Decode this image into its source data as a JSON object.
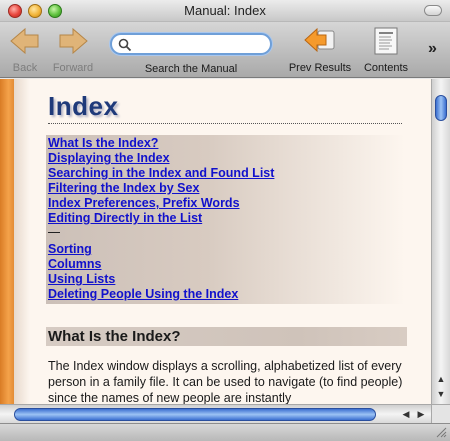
{
  "window": {
    "title": "Manual: Index"
  },
  "toolbar": {
    "back_label": "Back",
    "forward_label": "Forward",
    "search_label": "Search the Manual",
    "search_value": "",
    "prev_results_label": "Prev Results",
    "contents_label": "Contents",
    "overflow_glyph": "»"
  },
  "page": {
    "title": "Index",
    "toc": [
      "What Is the Index?",
      "Displaying the Index",
      "Searching in the Index and Found List",
      "Filtering the Index by Sex",
      "Index Preferences, Prefix Words ",
      "Editing Directly in the List"
    ],
    "toc_separator": "—",
    "toc_more": [
      "Sorting",
      "Columns",
      "Using Lists",
      "Deleting People Using the Index"
    ],
    "section_heading": "What Is the Index?",
    "body": "The Index window displays a scrolling, alphabetized list of every person in a family file. It can be used to navigate (to find people) since the names of new people are instantly"
  },
  "colors": {
    "accent_orange": "#f4a24a",
    "link_blue": "#1111cc",
    "title_blue": "#1f3a7a",
    "scroll_blue": "#3b6fd0"
  }
}
